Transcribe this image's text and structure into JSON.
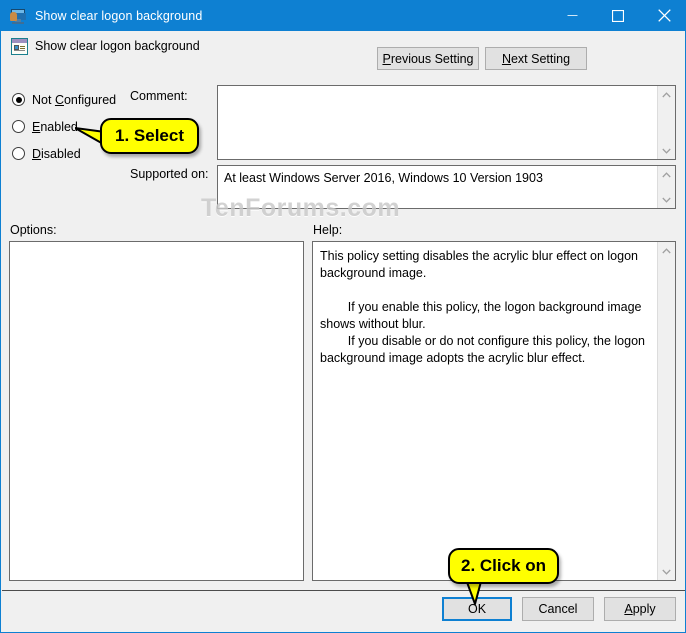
{
  "window": {
    "title": "Show clear logon background",
    "icon": "monitor-user-icon",
    "accent_color": "#0e80d2",
    "controls": {
      "minimize": "minimize-icon",
      "maximize": "maximize-icon",
      "close": "close-icon"
    }
  },
  "header": {
    "policy_title": "Show clear logon background",
    "icon": "group-policy-setting-icon",
    "previous_setting": "Previous Setting",
    "previous_setting_accel": "P",
    "next_setting": "Next Setting",
    "next_setting_accel": "N"
  },
  "state": {
    "options": [
      {
        "label": "Not Configured",
        "accel": "C",
        "prefix": "Not ",
        "suffix": "onfigured",
        "selected": true
      },
      {
        "label": "Enabled",
        "accel": "E",
        "prefix": "",
        "suffix": "nabled",
        "selected": false
      },
      {
        "label": "Disabled",
        "accel": "D",
        "prefix": "",
        "suffix": "isabled",
        "selected": false
      }
    ]
  },
  "fields": {
    "comment_label": "Comment:",
    "comment_value": "",
    "supported_label": "Supported on:",
    "supported_value": "At least Windows Server 2016, Windows 10 Version 1903"
  },
  "panes": {
    "options_label": "Options:",
    "options_value": "",
    "help_label": "Help:",
    "help_value": "This policy setting disables the acrylic blur effect on logon background image.\n\n        If you enable this policy, the logon background image shows without blur.\n        If you disable or do not configure this policy, the logon background image adopts the acrylic blur effect."
  },
  "footer": {
    "ok": "OK",
    "cancel": "Cancel",
    "apply": "Apply",
    "apply_accel": "A",
    "focused_button": "OK",
    "focus_color": "#0e80d2"
  },
  "annotations": {
    "callout_1": "1. Select",
    "callout_2": "2. Click on",
    "callout_bg": "#ffff00"
  },
  "watermark": {
    "text": "TenForums.com"
  }
}
